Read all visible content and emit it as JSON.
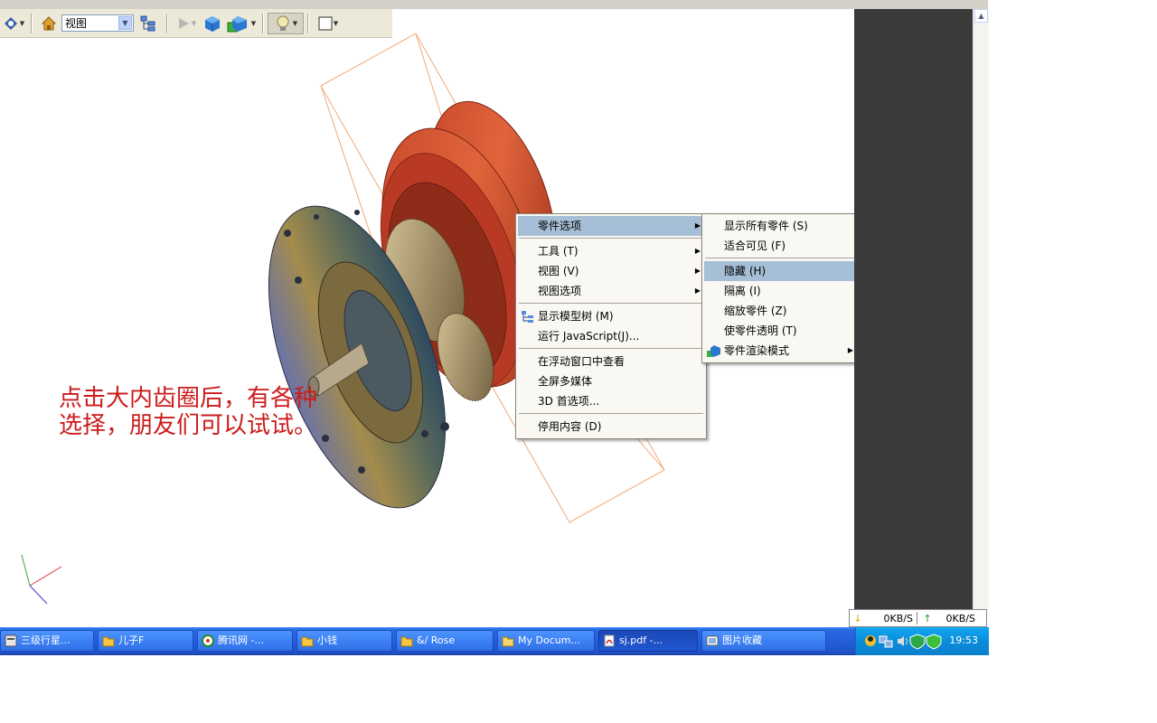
{
  "toolbar": {
    "view_select": "视图"
  },
  "annotation": "点击大内齿圈后，有各种选择，朋友们可以试试。",
  "context_menu": {
    "items": [
      {
        "label": "零件选项 ",
        "has_submenu": true,
        "selected": true
      },
      {
        "label": "工具 (T)",
        "has_submenu": true
      },
      {
        "label": "视图 (V)",
        "has_submenu": true
      },
      {
        "label": "视图选项",
        "has_submenu": true
      },
      {
        "label": "显示模型树 (M)"
      },
      {
        "label": "运行 JavaScript(J)..."
      },
      {
        "label": "在浮动窗口中查看"
      },
      {
        "label": "全屏多媒体"
      },
      {
        "label": "3D 首选项..."
      },
      {
        "label": "停用内容 (D)"
      }
    ]
  },
  "submenu": {
    "items": [
      {
        "label": "显示所有零件 (S)"
      },
      {
        "label": "适合可见 (F)"
      },
      {
        "label": "隐藏 (H)",
        "selected": true
      },
      {
        "label": "隔离 (I)"
      },
      {
        "label": "缩放零件 (Z)"
      },
      {
        "label": "使零件透明 (T)"
      },
      {
        "label": "零件渲染模式",
        "has_submenu": true
      }
    ]
  },
  "netspeed": {
    "down": "0KB/S",
    "up": "0KB/S"
  },
  "taskbar": {
    "tasks": [
      {
        "label": "三级行星..."
      },
      {
        "label": "儿子F"
      },
      {
        "label": "腾讯网 -..."
      },
      {
        "label": "小钱"
      },
      {
        "label": "&/ Rose"
      },
      {
        "label": "My Docum..."
      },
      {
        "label": "sj.pdf -...",
        "active": true
      },
      {
        "label": "图片收藏"
      }
    ],
    "clock": "19:53"
  },
  "colors": {
    "menu_highlight": "#a6bed6",
    "annotation": "#cc1b1b",
    "taskbar": "#245edb"
  }
}
